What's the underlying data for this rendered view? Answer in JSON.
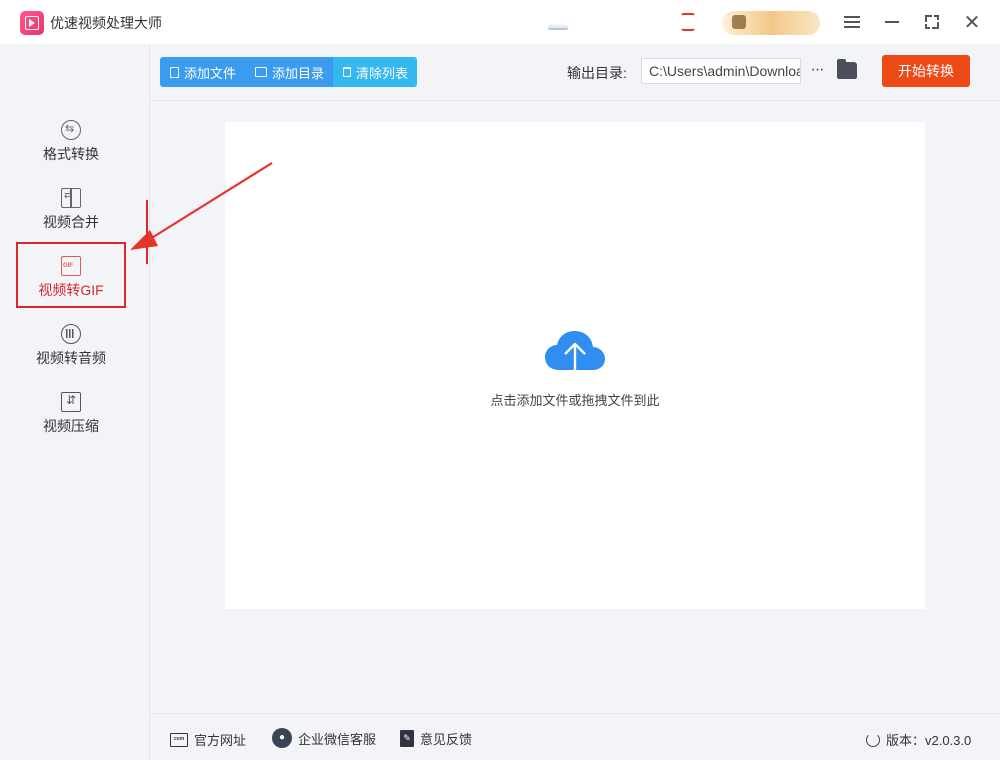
{
  "app": {
    "title": "优速视频处理大师"
  },
  "sidebar": {
    "items": [
      {
        "label": "格式转换",
        "icon": "format-convert-icon",
        "active": false
      },
      {
        "label": "视频合并",
        "icon": "video-merge-icon",
        "active": false
      },
      {
        "label": "视频转GIF",
        "icon": "gif-icon",
        "active": true
      },
      {
        "label": "视频转音频",
        "icon": "audio-icon",
        "active": false
      },
      {
        "label": "视频压缩",
        "icon": "compress-icon",
        "active": false
      }
    ]
  },
  "toolbar": {
    "add_file": "添加文件",
    "add_folder": "添加目录",
    "clear_list": "清除列表",
    "output_label": "输出目录:",
    "output_path": "C:\\Users\\admin\\Downloads",
    "more": "···",
    "start": "开始转换"
  },
  "main": {
    "drop_hint": "点击添加文件或拖拽文件到此"
  },
  "footer": {
    "website": "官方网址",
    "wechat": "企业微信客服",
    "feedback": "意见反馈",
    "version": "版本：v2.0.3.0"
  },
  "colors": {
    "primary": "#3a9bef",
    "start_button": "#ee4a18",
    "highlight": "#d8282e"
  }
}
